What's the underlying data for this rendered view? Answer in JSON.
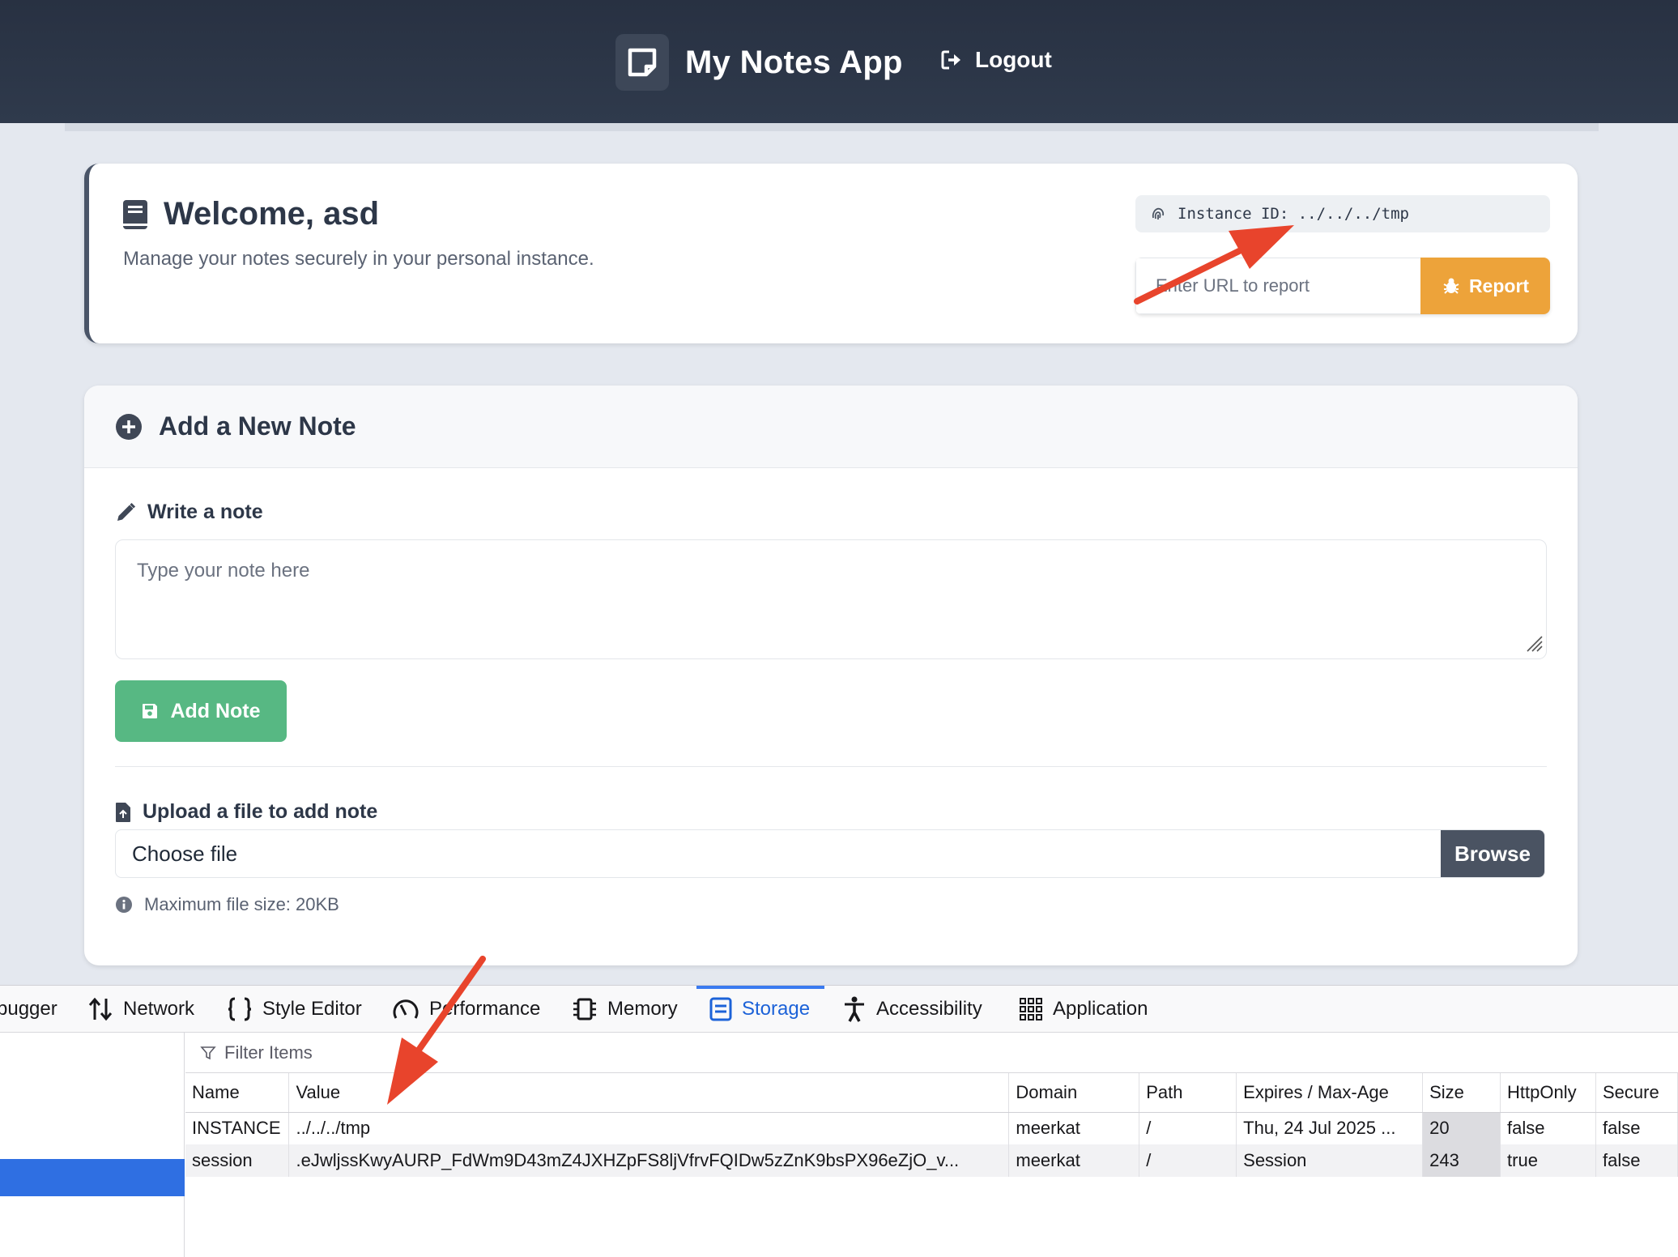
{
  "header": {
    "title": "My Notes App",
    "logout_label": "Logout"
  },
  "welcome": {
    "title": "Welcome, asd",
    "subtitle": "Manage your notes securely in your personal instance.",
    "instance_label": "Instance ID: ../../../tmp",
    "report_placeholder": "Enter URL to report",
    "report_button": "Report"
  },
  "add_note": {
    "title": "Add a New Note",
    "write_label": "Write a note",
    "note_placeholder": "Type your note here",
    "add_button": "Add Note",
    "upload_label": "Upload a file to add note",
    "choose_file": "Choose file",
    "browse_button": "Browse",
    "hint": "Maximum file size: 20KB"
  },
  "devtools": {
    "tabs": [
      {
        "label": "bugger",
        "icon": "debugger-icon"
      },
      {
        "label": "Network",
        "icon": "network-arrows-icon"
      },
      {
        "label": "Style Editor",
        "icon": "braces-icon"
      },
      {
        "label": "Performance",
        "icon": "gauge-icon"
      },
      {
        "label": "Memory",
        "icon": "chip-icon"
      },
      {
        "label": "Storage",
        "icon": "storage-icon",
        "active": true
      },
      {
        "label": "Accessibility",
        "icon": "accessibility-icon"
      },
      {
        "label": "Application",
        "icon": "grid-icon"
      }
    ],
    "filter_placeholder": "Filter Items",
    "columns": [
      "Name",
      "Value",
      "Domain",
      "Path",
      "Expires / Max-Age",
      "Size",
      "HttpOnly",
      "Secure"
    ],
    "rows": [
      {
        "name": "INSTANCE",
        "value": "../../../tmp",
        "domain": "meerkat",
        "path": "/",
        "expires": "Thu, 24 Jul 2025 ...",
        "size": "20",
        "httponly": "false",
        "secure": "false"
      },
      {
        "name": "session",
        "value": ".eJwljssKwyAURP_FdWm9D43mZ4JXHZpFS8ljVfrvFQIDw5zZnK9bsPX96eZjO_v...",
        "domain": "meerkat",
        "path": "/",
        "expires": "Session",
        "size": "243",
        "httponly": "true",
        "secure": "false"
      }
    ]
  },
  "colors": {
    "header_bg": "#2b3446",
    "report_button": "#eda33a",
    "add_button": "#57b883",
    "browse_button": "#4a5362",
    "devtools_active": "#1c62d8",
    "annotation_arrow": "#e8442c"
  }
}
